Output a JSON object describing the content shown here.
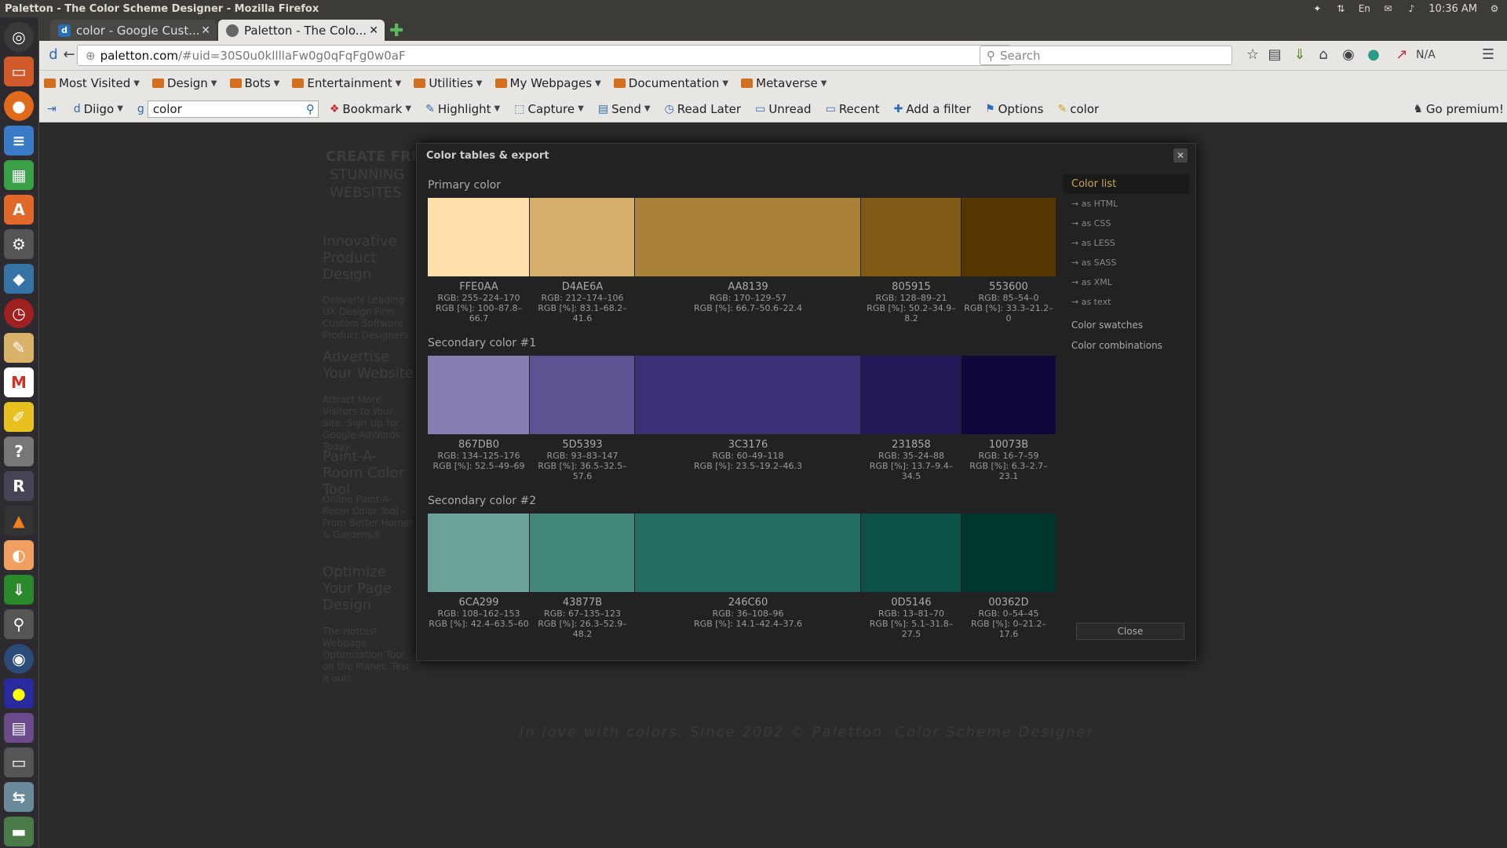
{
  "window": {
    "title": "Paletton - The Color Scheme Designer - Mozilla Firefox"
  },
  "tray": {
    "lang": "En",
    "time": "10:36 AM"
  },
  "tabs": [
    {
      "label": "color - Google Cust...",
      "icon": "d"
    },
    {
      "label": "Paletton - The Colo...",
      "icon": ""
    }
  ],
  "nav": {
    "url_host": "paletton.com",
    "url_path": "/#uid=30S0u0kllllaFw0g0qFqFg0w0aF",
    "search_placeholder": "Search",
    "na_label": "N/A"
  },
  "bookmarks": [
    "Most Visited",
    "Design",
    "Bots",
    "Entertainment",
    "Utilities",
    "My Webpages",
    "Documentation",
    "Metaverse"
  ],
  "diigo": {
    "diigo_label": "Diigo",
    "search_value": "color",
    "bookmark": "Bookmark",
    "highlight": "Highlight",
    "capture": "Capture",
    "send": "Send",
    "read_later": "Read Later",
    "unread": "Unread",
    "recent": "Recent",
    "add_filter": "Add a filter",
    "options": "Options",
    "color_tag": "color",
    "premium": "Go premium!"
  },
  "background": {
    "create_free": "CREATE FREE",
    "stunning": "STUNNING",
    "websites": "WEBSITES",
    "ads": [
      {
        "title": "Innovative Product Design",
        "body": "Denver's Leading UX Design Firm Custom Software Product Designers"
      },
      {
        "title": "Advertise Your Website",
        "body": "Attract More Visitors to Your Site. Sign Up for Google AdWords Today."
      },
      {
        "title": "Paint-A-Room Color Tool",
        "body": "Online Paint-A-Room Color Tool - From Better Homes & Gardens®"
      },
      {
        "title": "Optimize Your Page Design",
        "body": "The Hottest Webpage Optimization Tool on the Planet. Test it out!"
      }
    ],
    "footer_tagline": "In love with colors. Since 2002 © Paletton. Color Scheme Designer"
  },
  "modal": {
    "title": "Color tables & export",
    "close_label": "Close",
    "side": {
      "color_list": "Color list",
      "subs": [
        "→ as HTML",
        "→ as CSS",
        "→ as LESS",
        "→ as SASS",
        "→ as XML",
        "→ as text"
      ],
      "swatches": "Color swatches",
      "combinations": "Color combinations"
    },
    "groups": [
      {
        "label": "Primary color",
        "swatches": [
          {
            "hex": "FFE0AA",
            "color": "#FFE0AA",
            "rgb": "RGB: 255–224–170",
            "pct": "RGB [%]: 100–87.8–66.7"
          },
          {
            "hex": "D4AE6A",
            "color": "#D4AE6A",
            "rgb": "RGB: 212–174–106",
            "pct": "RGB [%]: 83.1–68.2–41.6"
          },
          {
            "hex": "AA8139",
            "color": "#AA8139",
            "rgb": "RGB: 170–129–57",
            "pct": "RGB [%]: 66.7–50.6–22.4"
          },
          {
            "hex": "805915",
            "color": "#805915",
            "rgb": "RGB: 128–89–21",
            "pct": "RGB [%]: 50.2–34.9–8.2"
          },
          {
            "hex": "553600",
            "color": "#553600",
            "rgb": "RGB: 85–54–0",
            "pct": "RGB [%]: 33.3–21.2–0"
          }
        ]
      },
      {
        "label": "Secondary color #1",
        "swatches": [
          {
            "hex": "867DB0",
            "color": "#867DB0",
            "rgb": "RGB: 134–125–176",
            "pct": "RGB [%]: 52.5–49–69"
          },
          {
            "hex": "5D5393",
            "color": "#5D5393",
            "rgb": "RGB: 93–83–147",
            "pct": "RGB [%]: 36.5–32.5–57.6"
          },
          {
            "hex": "3C3176",
            "color": "#3C3176",
            "rgb": "RGB: 60–49–118",
            "pct": "RGB [%]: 23.5–19.2–46.3"
          },
          {
            "hex": "231858",
            "color": "#231858",
            "rgb": "RGB: 35–24–88",
            "pct": "RGB [%]: 13.7–9.4–34.5"
          },
          {
            "hex": "10073B",
            "color": "#10073B",
            "rgb": "RGB: 16–7–59",
            "pct": "RGB [%]: 6.3–2.7–23.1"
          }
        ]
      },
      {
        "label": "Secondary color #2",
        "swatches": [
          {
            "hex": "6CA299",
            "color": "#6CA299",
            "rgb": "RGB: 108–162–153",
            "pct": "RGB [%]: 42.4–63.5–60"
          },
          {
            "hex": "43877B",
            "color": "#43877B",
            "rgb": "RGB: 67–135–123",
            "pct": "RGB [%]: 26.3–52.9–48.2"
          },
          {
            "hex": "246C60",
            "color": "#246C60",
            "rgb": "RGB: 36–108–96",
            "pct": "RGB [%]: 14.1–42.4–37.6"
          },
          {
            "hex": "0D5146",
            "color": "#0D5146",
            "rgb": "RGB: 13–81–70",
            "pct": "RGB [%]: 5.1–31.8–27.5"
          },
          {
            "hex": "00362D",
            "color": "#00362D",
            "rgb": "RGB: 0–54–45",
            "pct": "RGB [%]: 0–21.2–17.6"
          }
        ]
      }
    ]
  }
}
